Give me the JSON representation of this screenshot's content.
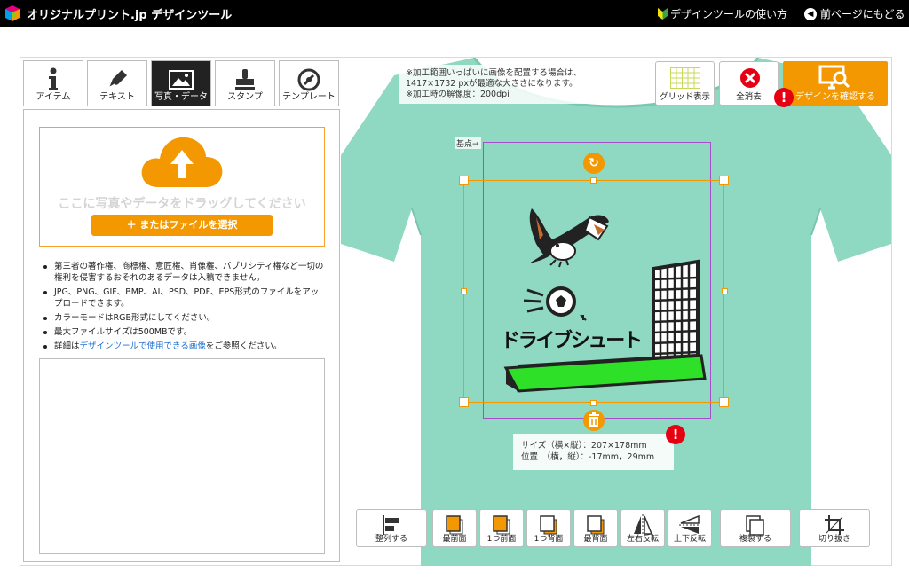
{
  "header": {
    "brand": "オリジナルプリント.jp デザインツール",
    "help_link": "デザインツールの使い方",
    "back_link": "前ページにもどる"
  },
  "tabs": [
    {
      "label": "アイテム",
      "icon": "info-icon"
    },
    {
      "label": "テキスト",
      "icon": "pen-icon"
    },
    {
      "label": "写真・データ",
      "icon": "image-icon",
      "active": true
    },
    {
      "label": "スタンプ",
      "icon": "stamp-icon"
    },
    {
      "label": "テンプレート",
      "icon": "template-icon"
    }
  ],
  "upload": {
    "drop_text": "ここに写真やデータをドラッグしてください",
    "file_button": "＋ またはファイルを選択"
  },
  "notes": [
    "第三者の著作権、商標権、意匠権、肖像権、パブリシティ権など一切の権利を侵害するおそれのあるデータは入稿できません。",
    "JPG、PNG、GIF、BMP、AI、PSD、PDF、EPS形式のファイルをアップロードできます。",
    "カラーモードはRGB形式にしてください。",
    "最大ファイルサイズは500MBです。"
  ],
  "detail_note": {
    "prefix": "詳細は",
    "link": "デザインツールで使用できる画像",
    "suffix": "をご参照ください。"
  },
  "info_top": {
    "line1": "※加工範囲いっぱいに画像を配置する場合は、",
    "line2": "1417×1732 pxが最適な大きさになります。",
    "line3": "※加工時の解像度：200dpi"
  },
  "toolbar": {
    "grid": "グリッド表示",
    "clear": "全消去",
    "confirm": "デザインを確認する"
  },
  "canvas": {
    "origin_label": "基点",
    "design_text": "ドライブシュート",
    "shirt_color": "#8fd8c1",
    "accent_color": "#f39800",
    "alert_mark": "!"
  },
  "dims": {
    "size_line": "サイズ（横×縦）：207×178mm",
    "pos_line": "位置　（横，縦）：-17mm，29mm"
  },
  "bottom_tools": [
    "整列する",
    "最前面",
    "1つ前面",
    "1つ背面",
    "最背面",
    "左右反転",
    "上下反転",
    "複製する",
    "切り抜き"
  ]
}
